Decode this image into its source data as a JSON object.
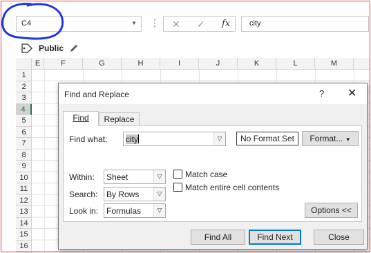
{
  "formula_bar": {
    "name_box": "C4",
    "cancel_glyph": "✕",
    "enter_glyph": "✓",
    "fx_glyph": "fx",
    "formula": "city"
  },
  "sensitivity": {
    "label": "Public"
  },
  "sheet": {
    "columns": [
      "E",
      "F",
      "G",
      "H",
      "I",
      "J",
      "K",
      "L",
      "M"
    ],
    "rows": [
      "1",
      "2",
      "3",
      "4",
      "5",
      "6",
      "7",
      "8",
      "9",
      "10",
      "11",
      "12",
      "13",
      "14",
      "15",
      "16"
    ],
    "active_row": "4"
  },
  "dialog": {
    "title": "Find and Replace",
    "help": "?",
    "close": "✕",
    "tabs": {
      "find": "Find",
      "replace": "Replace"
    },
    "find_what_label": "Find what:",
    "find_what_value": "city",
    "format_status": "No Format Set",
    "format_button": "Format...",
    "within_label": "Within:",
    "within_value": "Sheet",
    "search_label": "Search:",
    "search_value": "By Rows",
    "lookin_label": "Look in:",
    "lookin_value": "Formulas",
    "match_case": "Match case",
    "match_entire": "Match entire cell contents",
    "options_button": "Options <<",
    "find_all": "Find All",
    "find_next": "Find Next",
    "close_button": "Close"
  },
  "colors": {
    "annotation_blue": "#1d39e0",
    "border_red": "#e23c3c",
    "excel_green": "#217346"
  }
}
